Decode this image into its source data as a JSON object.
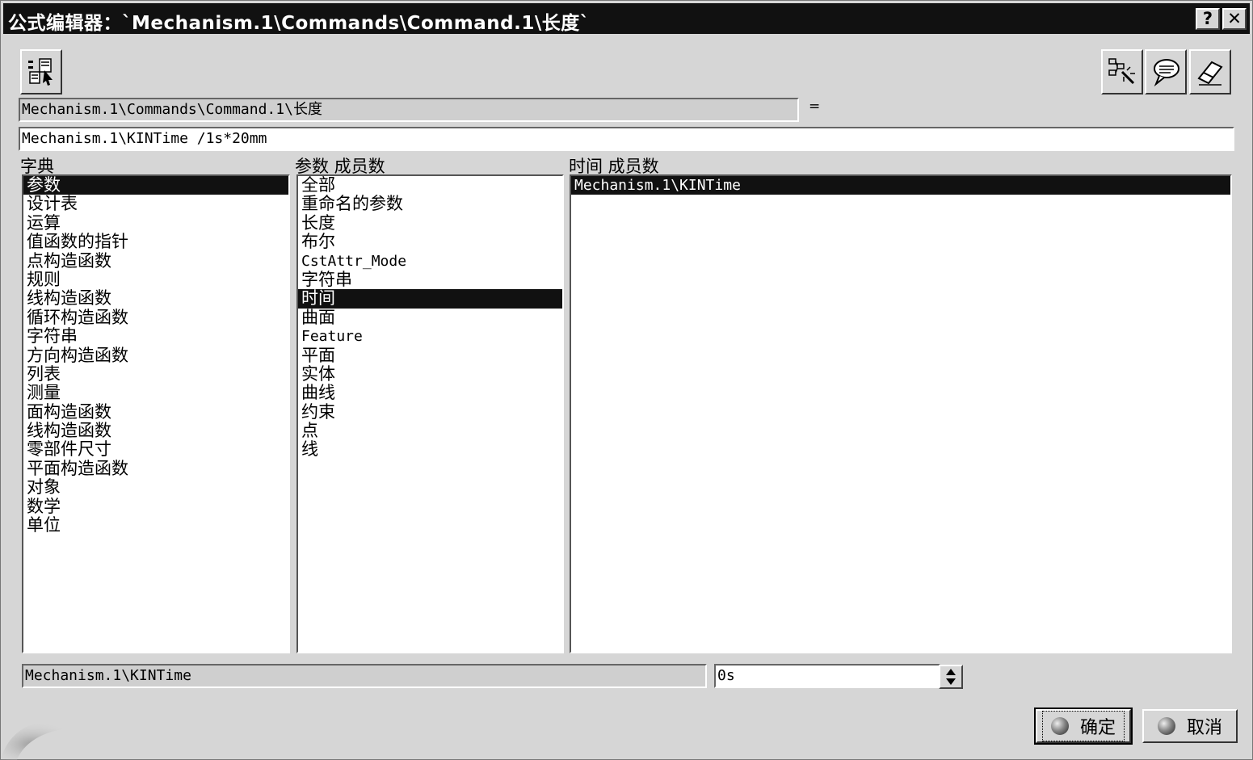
{
  "window": {
    "title": "公式编辑器：`Mechanism.1\\Commands\\Command.1\\长度`",
    "help_label": "?",
    "close_label": "✕"
  },
  "toolbar": {
    "left_icon": "formula-tree-icon",
    "right_icons": [
      "wizard-icon",
      "speech-bubble-icon",
      "eraser-icon"
    ]
  },
  "formula": {
    "target": "Mechanism.1\\Commands\\Command.1\\长度",
    "equals": "=",
    "expression": "Mechanism.1\\KINTime /1s*20mm"
  },
  "dictionary": {
    "label": "字典",
    "items": [
      "参数",
      "设计表",
      "运算",
      "值函数的指针",
      "点构造函数",
      "规则",
      "线构造函数",
      "循环构造函数",
      "字符串",
      "方向构造函数",
      "列表",
      "测量",
      "面构造函数",
      "线构造函数",
      "零部件尺寸",
      "平面构造函数",
      "对象",
      "数学",
      "单位"
    ],
    "selected_index": 0
  },
  "members_of_parameters": {
    "label": "参数 成员数",
    "items": [
      "全部",
      "重命名的参数",
      "长度",
      "布尔",
      "CstAttr_Mode",
      "字符串",
      "时间",
      "曲面",
      "Feature",
      "平面",
      "实体",
      "曲线",
      "约束",
      "点",
      "线"
    ],
    "selected_index": 6
  },
  "members_of_time": {
    "label": "时间 成员数",
    "items": [
      "Mechanism.1\\KINTime"
    ],
    "selected_index": 0
  },
  "bottom": {
    "selected_param": "Mechanism.1\\KINTime",
    "value": "0s"
  },
  "buttons": {
    "ok_label": "确定",
    "cancel_label": "取消"
  }
}
